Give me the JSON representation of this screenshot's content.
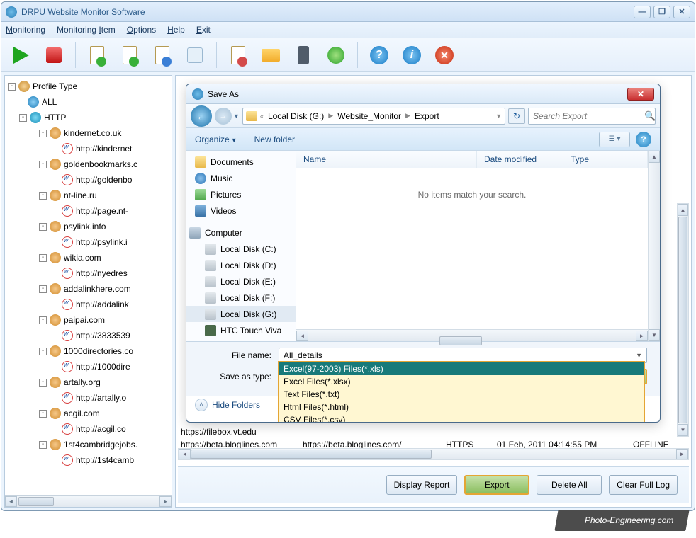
{
  "app": {
    "title": "DRPU Website Monitor Software"
  },
  "menu": {
    "monitoring": "Monitoring",
    "monitoring_item": "Monitoring Item",
    "options": "Options",
    "help": "Help",
    "exit": "Exit"
  },
  "sidebar": {
    "root": "Profile Type",
    "all": "ALL",
    "http": "HTTP",
    "sites": [
      {
        "domain": "kindernet.co.uk",
        "url": "http://kindernet"
      },
      {
        "domain": "goldenbookmarks.c",
        "url": "http://goldenbo"
      },
      {
        "domain": "nt-line.ru",
        "url": "http://page.nt-"
      },
      {
        "domain": "psylink.info",
        "url": "http://psylink.i"
      },
      {
        "domain": "wikia.com",
        "url": "http://nyedres"
      },
      {
        "domain": "addalinkhere.com",
        "url": "http://addalink"
      },
      {
        "domain": "paipai.com",
        "url": "http://3833539"
      },
      {
        "domain": "1000directories.co",
        "url": "http://1000dire"
      },
      {
        "domain": "artally.org",
        "url": "http://artally.o"
      },
      {
        "domain": "acgil.com",
        "url": "http://acgil.co"
      },
      {
        "domain": "1st4cambridgejobs.",
        "url": "http://1st4camb"
      }
    ]
  },
  "saveAs": {
    "title": "Save As",
    "breadcrumb": [
      "Local Disk (G:)",
      "Website_Monitor",
      "Export"
    ],
    "searchPlaceholder": "Search Export",
    "organize": "Organize",
    "newFolder": "New folder",
    "treeItems": {
      "documents": "Documents",
      "music": "Music",
      "pictures": "Pictures",
      "videos": "Videos",
      "computer": "Computer",
      "disks": [
        "Local Disk (C:)",
        "Local Disk (D:)",
        "Local Disk (E:)",
        "Local Disk (F:)",
        "Local Disk (G:)",
        "HTC Touch Viva"
      ]
    },
    "selectedDisk": "Local Disk (G:)",
    "columns": {
      "name": "Name",
      "date": "Date modified",
      "type": "Type"
    },
    "emptyMessage": "No items match your search.",
    "fileNameLabel": "File name:",
    "fileName": "All_details",
    "saveTypeLabel": "Save as type:",
    "saveType": "Excel(97-2003) Files(*.xls)",
    "typeOptions": [
      "Excel(97-2003) Files(*.xls)",
      "Excel Files(*.xlsx)",
      "Text Files(*.txt)",
      "Html Files(*.html)",
      "CSV Files(*.csv)"
    ],
    "hideFolders": "Hide Folders"
  },
  "records": [
    {
      "c1": "https://filebox.vt.edu",
      "c2": "",
      "c3": "",
      "c4": "",
      "c5": ""
    },
    {
      "c1": "https://beta.bloglines.com",
      "c2": "https://beta.bloglines.com/",
      "c3": "HTTPS",
      "c4": "01 Feb, 2011 04:14:55 PM",
      "c5": "OFFLINE"
    }
  ],
  "buttons": {
    "displayReport": "Display Report",
    "export": "Export",
    "deleteAll": "Delete All",
    "clearLog": "Clear Full Log"
  },
  "watermark": "Photo-Engineering.com"
}
